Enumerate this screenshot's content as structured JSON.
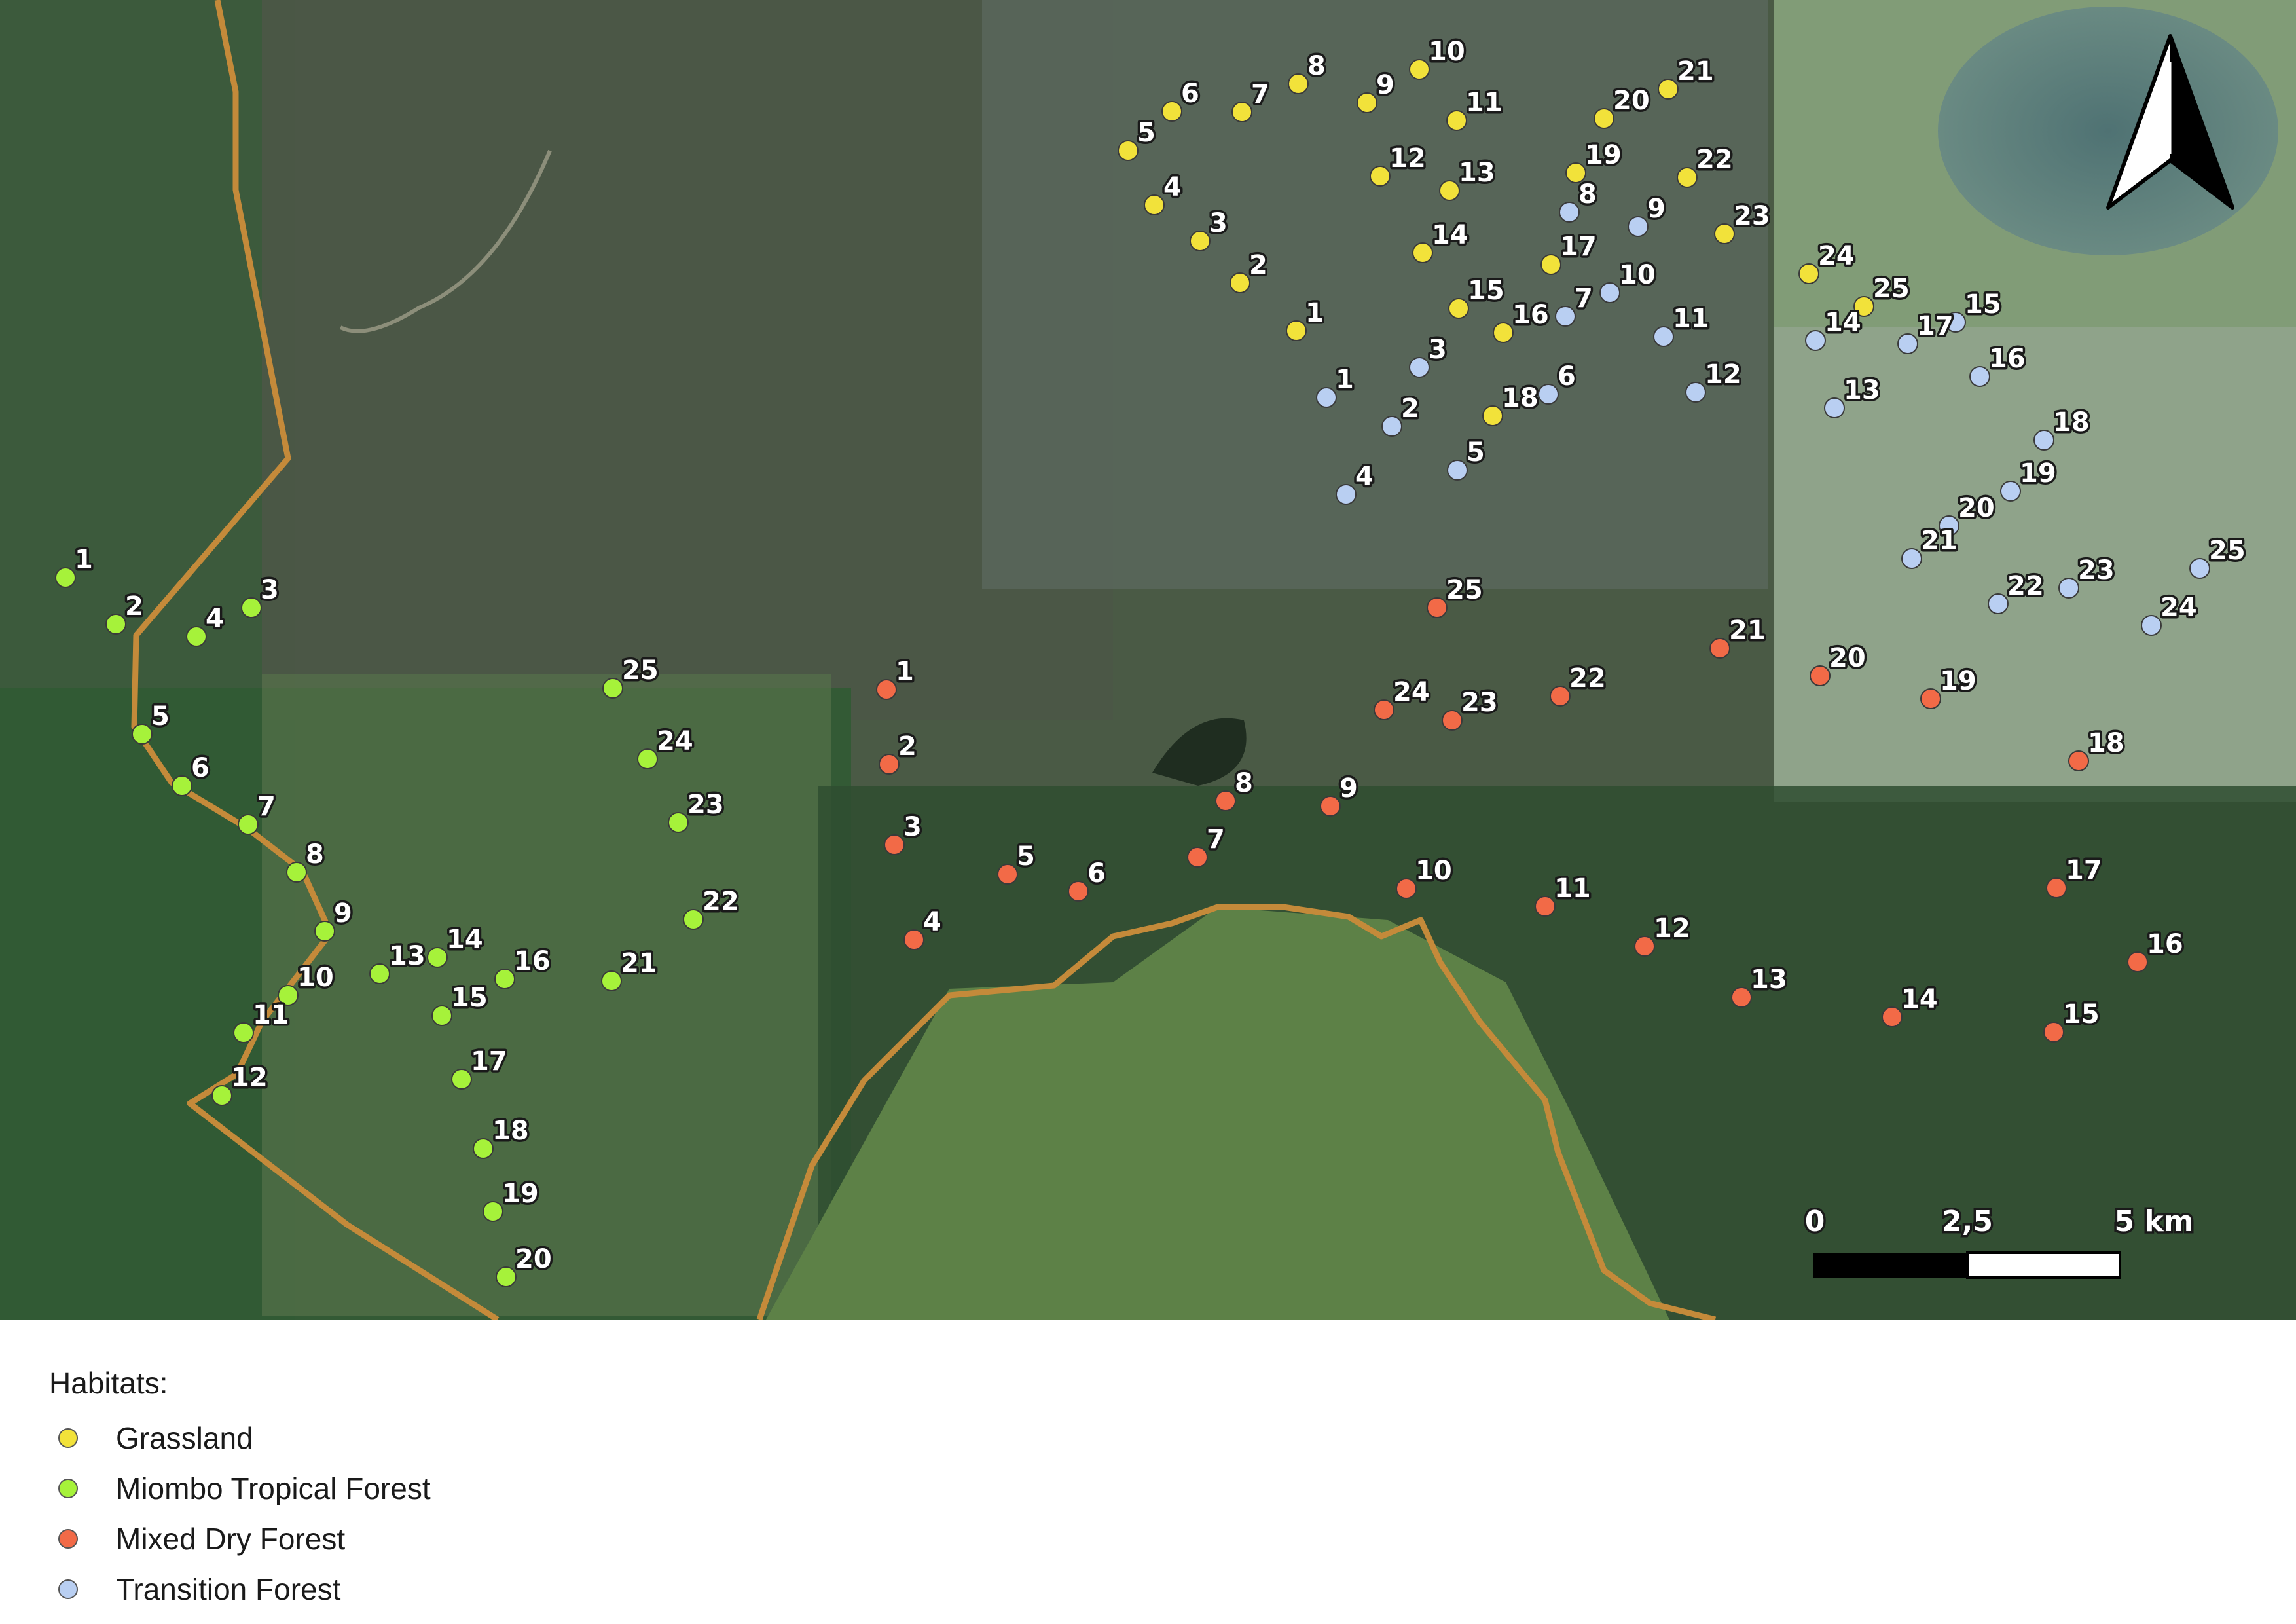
{
  "map": {
    "north_arrow_icon": "north-arrow-icon",
    "boundary_color": "#c48a3a",
    "scale_bar": {
      "labels": [
        "0",
        "2,5",
        "5 km"
      ]
    }
  },
  "legend": {
    "title": "Habitats:",
    "items": [
      {
        "key": "grassland",
        "label": "Grassland",
        "color": "#f2e23a"
      },
      {
        "key": "miombo",
        "label": "Miombo Tropical Forest",
        "color": "#a6f23a"
      },
      {
        "key": "mixed",
        "label": "Mixed Dry Forest",
        "color": "#f26a47"
      },
      {
        "key": "transition",
        "label": "Transition Forest",
        "color": "#b9cff2"
      }
    ]
  },
  "sites": {
    "grassland": [
      "1",
      "2",
      "3",
      "4",
      "5",
      "6",
      "7",
      "8",
      "9",
      "10",
      "11",
      "12",
      "13",
      "14",
      "15",
      "16",
      "17",
      "18",
      "19",
      "20",
      "21",
      "22",
      "23",
      "24",
      "25"
    ],
    "miombo": [
      "1",
      "2",
      "3",
      "4",
      "5",
      "6",
      "7",
      "8",
      "9",
      "10",
      "11",
      "12",
      "13",
      "14",
      "15",
      "16",
      "17",
      "18",
      "19",
      "20",
      "21",
      "22",
      "23",
      "24",
      "25"
    ],
    "mixed": [
      "1",
      "2",
      "3",
      "4",
      "5",
      "6",
      "7",
      "8",
      "9",
      "10",
      "11",
      "12",
      "13",
      "14",
      "15",
      "16",
      "17",
      "18",
      "19",
      "20",
      "21",
      "22",
      "23",
      "24",
      "25"
    ],
    "transition": [
      "1",
      "2",
      "3",
      "4",
      "5",
      "6",
      "7",
      "8",
      "9",
      "10",
      "11",
      "12",
      "13",
      "14",
      "15",
      "16",
      "17",
      "18",
      "19",
      "20",
      "21",
      "22",
      "23",
      "24",
      "25"
    ]
  }
}
